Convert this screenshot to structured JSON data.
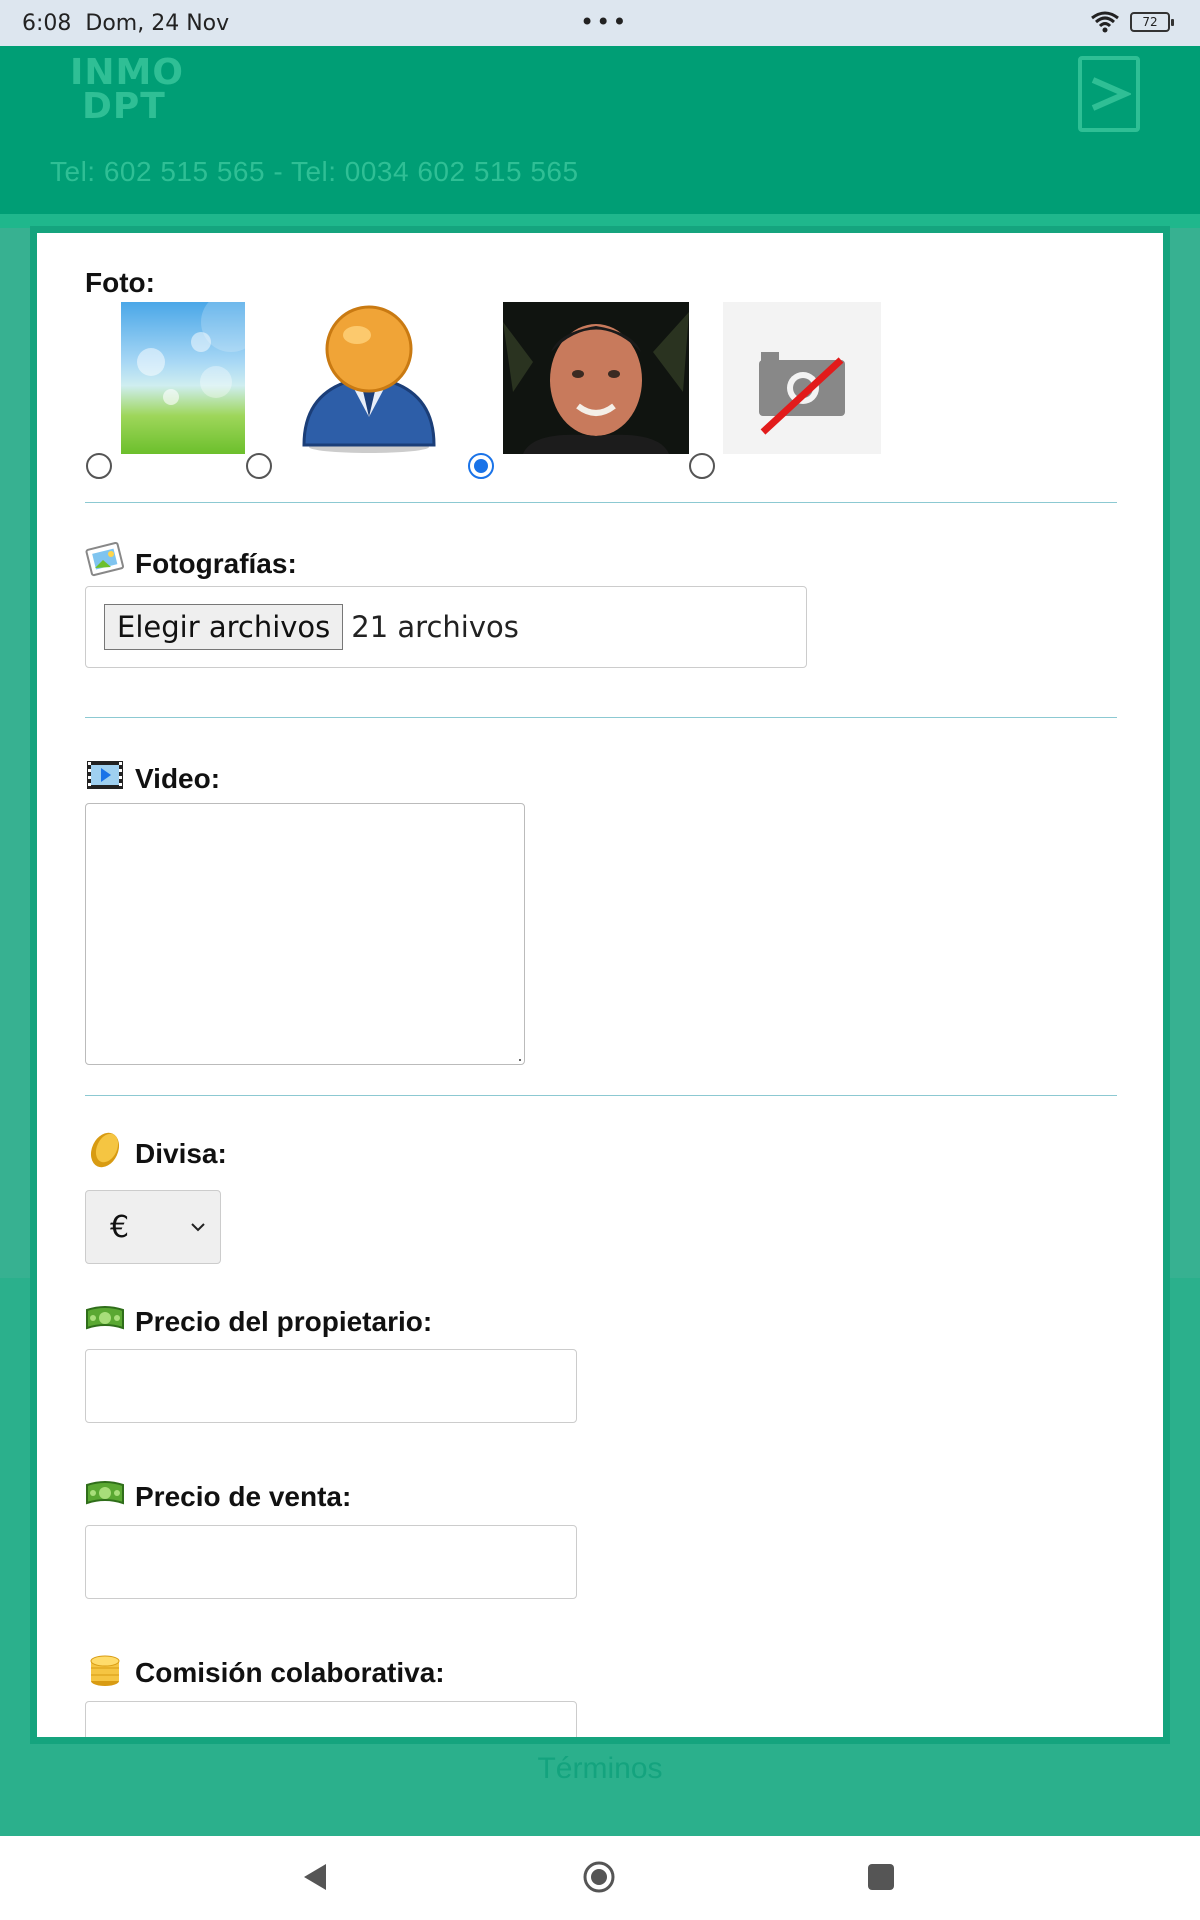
{
  "status_bar": {
    "time": "6:08",
    "date": "Dom, 24 Nov",
    "more": "•••",
    "battery": "72"
  },
  "header": {
    "logo_line1": "INMO",
    "logo_line2": "DPT",
    "phones": "Tel: 602 515 565 - Tel: 0034 602 515 565"
  },
  "form": {
    "foto_label": "Foto:",
    "foto_options": [
      {
        "selected": false
      },
      {
        "selected": false
      },
      {
        "selected": true
      },
      {
        "selected": false
      }
    ],
    "fotografias_label": "Fotografías:",
    "file_button": "Elegir archivos",
    "file_status": "21 archivos",
    "video_label": "Video:",
    "video_value": "",
    "divisa_label": "Divisa:",
    "divisa_value": "€",
    "precio_propietario_label": "Precio del propietario:",
    "precio_propietario_value": "",
    "precio_venta_label": "Precio de venta:",
    "precio_venta_value": "",
    "comision_label": "Comisión colaborativa:",
    "comision_value": ""
  },
  "footer": {
    "terminos": "Términos"
  },
  "colors": {
    "header": "#009e75",
    "page": "#2bb08c",
    "accent_link": "#14a37e",
    "radio_checked": "#1a73e8"
  }
}
